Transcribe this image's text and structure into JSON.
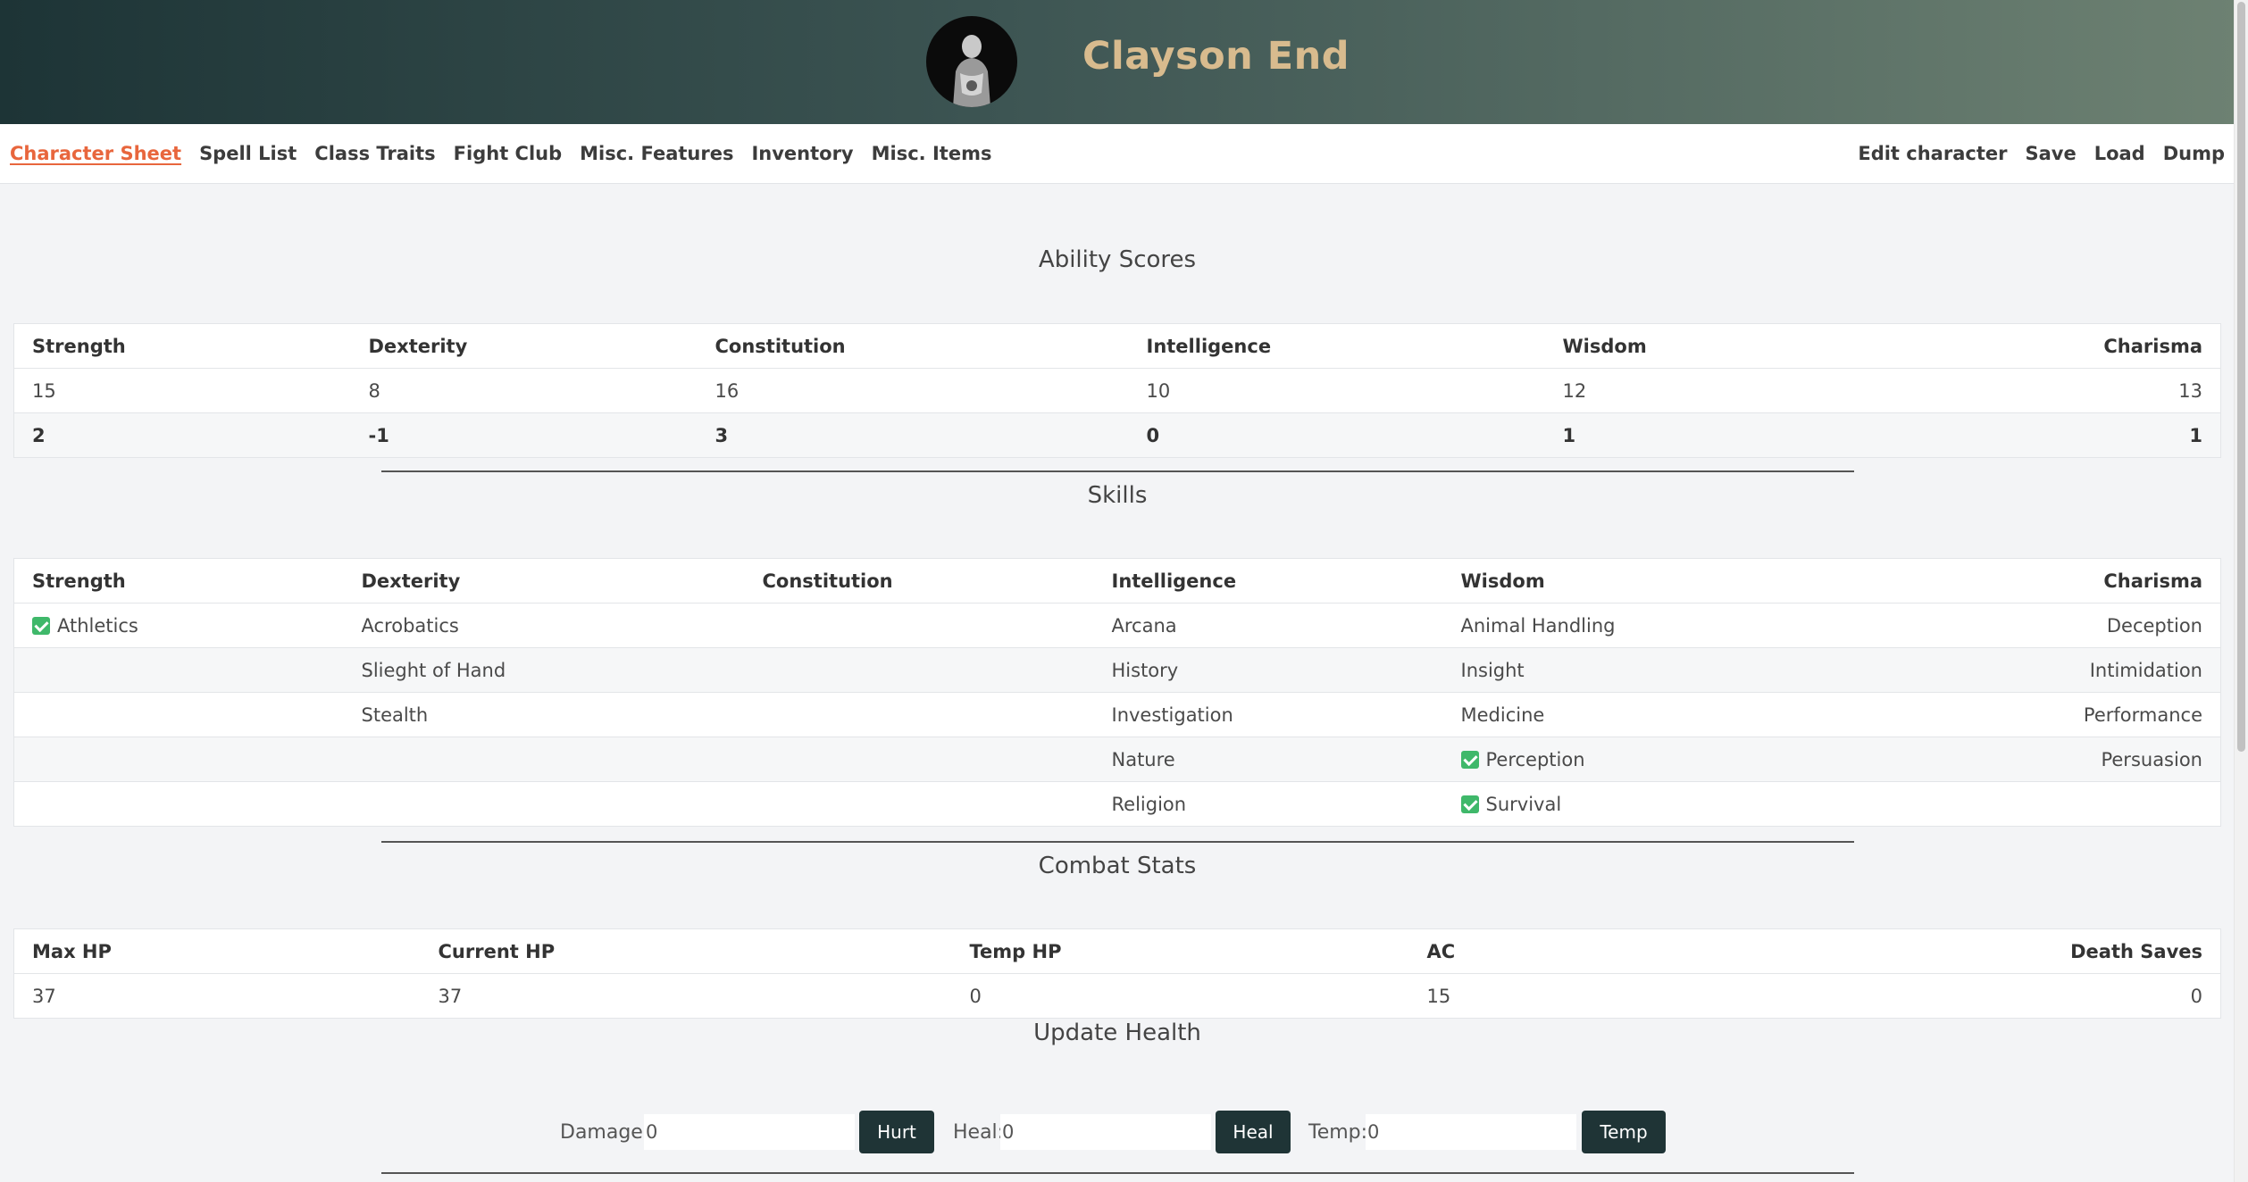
{
  "header": {
    "character_name": "Clayson End"
  },
  "nav": {
    "left": [
      "Character Sheet",
      "Spell List",
      "Class Traits",
      "Fight Club",
      "Misc. Features",
      "Inventory",
      "Misc. Items"
    ],
    "right": [
      "Edit character",
      "Save",
      "Load",
      "Dump"
    ],
    "active": "Character Sheet"
  },
  "ability_scores": {
    "title": "Ability Scores",
    "headers": [
      "Strength",
      "Dexterity",
      "Constitution",
      "Intelligence",
      "Wisdom",
      "Charisma"
    ],
    "scores": [
      "15",
      "8",
      "16",
      "10",
      "12",
      "13"
    ],
    "modifiers": [
      "2",
      "-1",
      "3",
      "0",
      "1",
      "1"
    ]
  },
  "skills": {
    "title": "Skills",
    "headers": [
      "Strength",
      "Dexterity",
      "Constitution",
      "Intelligence",
      "Wisdom",
      "Charisma"
    ],
    "rows": [
      [
        {
          "label": "Athletics",
          "proficient": true
        },
        {
          "label": "Acrobatics"
        },
        {
          "label": ""
        },
        {
          "label": "Arcana"
        },
        {
          "label": "Animal Handling"
        },
        {
          "label": "Deception"
        }
      ],
      [
        {
          "label": ""
        },
        {
          "label": "Slieght of Hand"
        },
        {
          "label": ""
        },
        {
          "label": "History"
        },
        {
          "label": "Insight"
        },
        {
          "label": "Intimidation"
        }
      ],
      [
        {
          "label": ""
        },
        {
          "label": "Stealth"
        },
        {
          "label": ""
        },
        {
          "label": "Investigation"
        },
        {
          "label": "Medicine"
        },
        {
          "label": "Performance"
        }
      ],
      [
        {
          "label": ""
        },
        {
          "label": ""
        },
        {
          "label": ""
        },
        {
          "label": "Nature"
        },
        {
          "label": "Perception",
          "proficient": true
        },
        {
          "label": "Persuasion"
        }
      ],
      [
        {
          "label": ""
        },
        {
          "label": ""
        },
        {
          "label": ""
        },
        {
          "label": "Religion"
        },
        {
          "label": "Survival",
          "proficient": true
        },
        {
          "label": ""
        }
      ]
    ]
  },
  "combat": {
    "title": "Combat Stats",
    "headers": [
      "Max HP",
      "Current HP",
      "Temp HP",
      "AC",
      "Death Saves"
    ],
    "values": [
      "37",
      "37",
      "0",
      "15",
      "0"
    ]
  },
  "update_health": {
    "title": "Update Health",
    "damage_label": "Damage:",
    "damage_value": "0",
    "hurt_button": "Hurt",
    "heal_label": "Heal:",
    "heal_value": "0",
    "heal_button": "Heal",
    "temp_label": "Temp:",
    "temp_value": "0",
    "temp_button": "Temp"
  },
  "colors": {
    "accent": "#e8663d",
    "header_dark": "#1d3436",
    "header_light": "#6d8172",
    "name": "#d8bb8e",
    "button": "#1f3436",
    "check": "#3fb86a"
  }
}
